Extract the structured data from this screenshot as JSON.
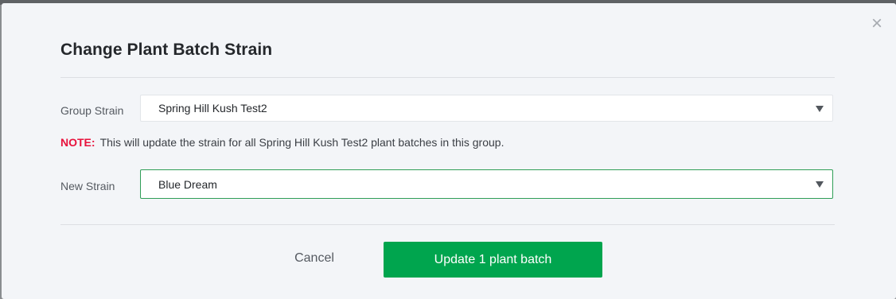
{
  "dialog": {
    "title": "Change Plant Batch Strain",
    "close_glyph": "×"
  },
  "group_strain": {
    "label": "Group Strain",
    "selected": "Spring Hill Kush Test2"
  },
  "note": {
    "label": "NOTE:",
    "text": "This will update the strain for all Spring Hill Kush Test2 plant batches in this group."
  },
  "new_strain": {
    "label": "New Strain",
    "selected": "Blue Dream"
  },
  "actions": {
    "cancel_label": "Cancel",
    "submit_label": "Update 1 plant batch"
  },
  "colors": {
    "primary_button": "#00a54e",
    "active_border": "#2f9e57",
    "note_label": "#e8123c",
    "dialog_background": "#f3f5f8"
  },
  "icons": {
    "close": "close-icon",
    "dropdown": "chevron-down-icon"
  }
}
